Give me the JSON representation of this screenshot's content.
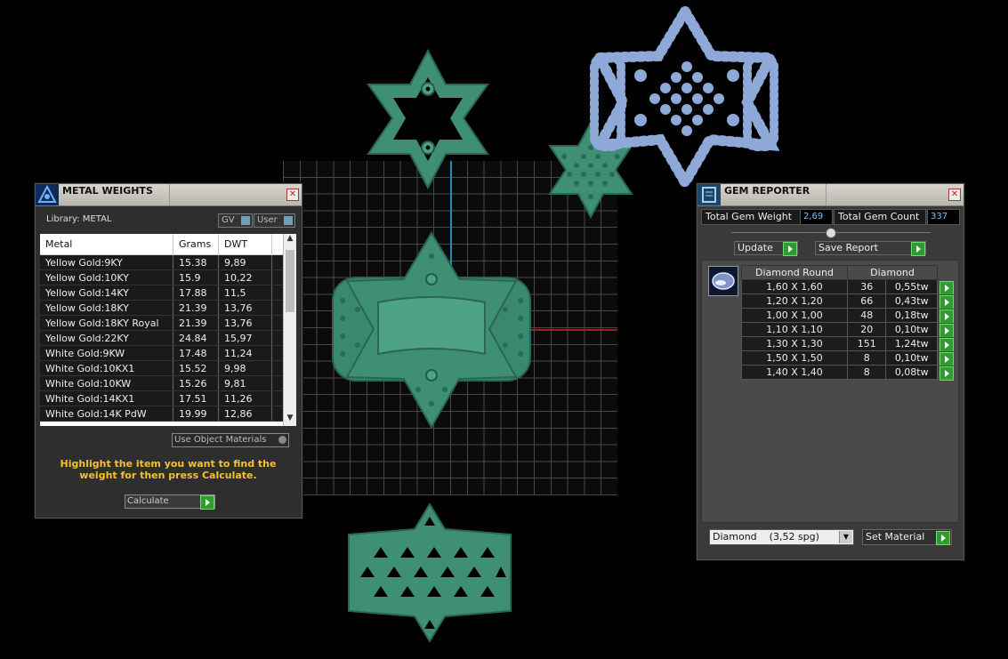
{
  "metal_weights": {
    "title": "METAL WEIGHTS",
    "library_label": "Library: METAL",
    "gv_label": "GV",
    "user_label": "User",
    "columns": [
      "Metal",
      "Grams",
      "DWT"
    ],
    "rows": [
      [
        "Yellow Gold:9KY",
        "15.38",
        "9,89"
      ],
      [
        "Yellow Gold:10KY",
        "15.9",
        "10,22"
      ],
      [
        "Yellow Gold:14KY",
        "17.88",
        "11,5"
      ],
      [
        "Yellow Gold:18KY",
        "21.39",
        "13,76"
      ],
      [
        "Yellow Gold:18KY Royal",
        "21.39",
        "13,76"
      ],
      [
        "Yellow Gold:22KY",
        "24.84",
        "15,97"
      ],
      [
        "White Gold:9KW",
        "17.48",
        "11,24"
      ],
      [
        "White Gold:10KX1",
        "15.52",
        "9,98"
      ],
      [
        "White Gold:10KW",
        "15.26",
        "9,81"
      ],
      [
        "White Gold:14KX1",
        "17.51",
        "11,26"
      ],
      [
        "White Gold:14K PdW",
        "19.99",
        "12,86"
      ]
    ],
    "use_object_materials": "Use Object Materials",
    "hint": "Highlight the item you want to find the weight for then press Calculate.",
    "calculate_label": "Calculate",
    "close": "✕"
  },
  "gem_reporter": {
    "title": "GEM REPORTER",
    "total_weight_label": "Total Gem Weight",
    "total_weight_value": "2,69",
    "total_count_label": "Total Gem Count",
    "total_count_value": "337",
    "update_label": "Update",
    "save_report_label": "Save Report",
    "table_headers": [
      "Diamond Round",
      "Diamond"
    ],
    "rows": [
      [
        "1,60 X 1,60",
        "36",
        "0,55tw"
      ],
      [
        "1,20 X 1,20",
        "66",
        "0,43tw"
      ],
      [
        "1,00 X 1,00",
        "48",
        "0,18tw"
      ],
      [
        "1,10 X 1,10",
        "20",
        "0,10tw"
      ],
      [
        "1,30 X 1,30",
        "151",
        "1,24tw"
      ],
      [
        "1,50 X 1,50",
        "8",
        "0,10tw"
      ],
      [
        "1,40 X 1,40",
        "8",
        "0,08tw"
      ]
    ],
    "material_dropdown": "Diamond    (3,52 spg)",
    "set_material_label": "Set Material",
    "close": "✕"
  },
  "colors": {
    "model_green": "#3f8f74",
    "gem_blue": "#8ea8d8",
    "hint_yellow": "#f2c230",
    "value_cyan": "#6cc9ff"
  }
}
